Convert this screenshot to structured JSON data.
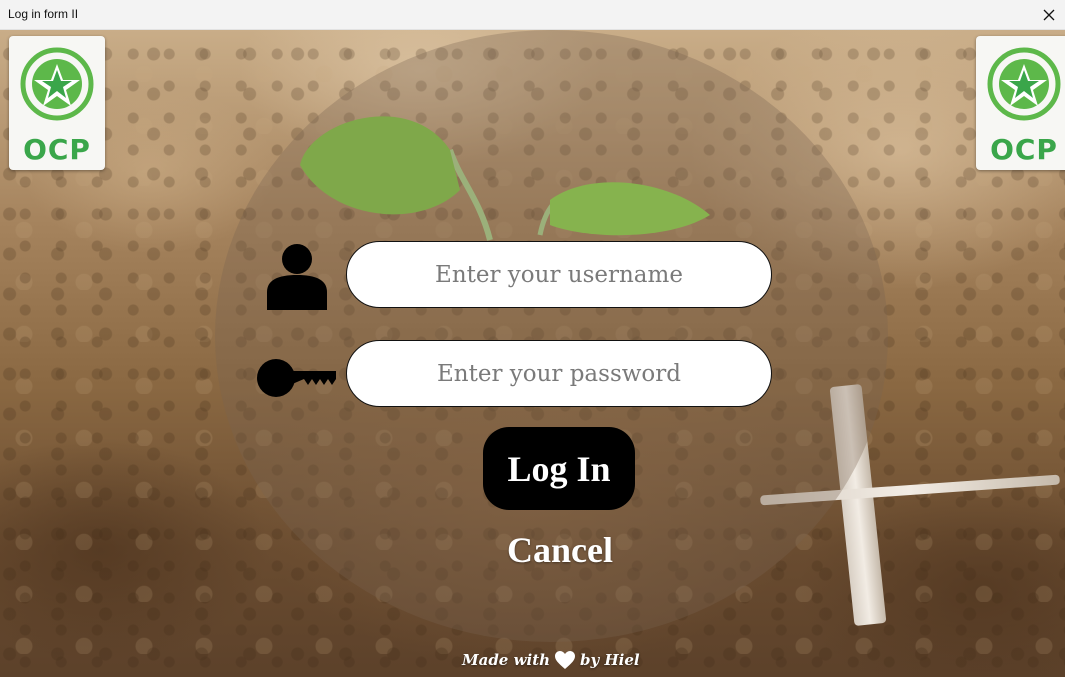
{
  "window": {
    "title": "Log in form II"
  },
  "logo": {
    "text": "OCP"
  },
  "form": {
    "username_placeholder": "Enter your username",
    "username_value": "",
    "password_placeholder": "Enter your password",
    "password_value": "",
    "login_label": "Log In",
    "cancel_label": "Cancel"
  },
  "footer": {
    "made_with": "Made with",
    "by": "by Hiel"
  },
  "icons": {
    "user": "user-icon",
    "key": "key-icon",
    "heart": "heart-icon",
    "close": "close-icon",
    "logo": "ocp-star-logo"
  },
  "colors": {
    "logo_green": "#3aa64a",
    "button_bg": "#000000",
    "field_bg": "#ffffff"
  }
}
